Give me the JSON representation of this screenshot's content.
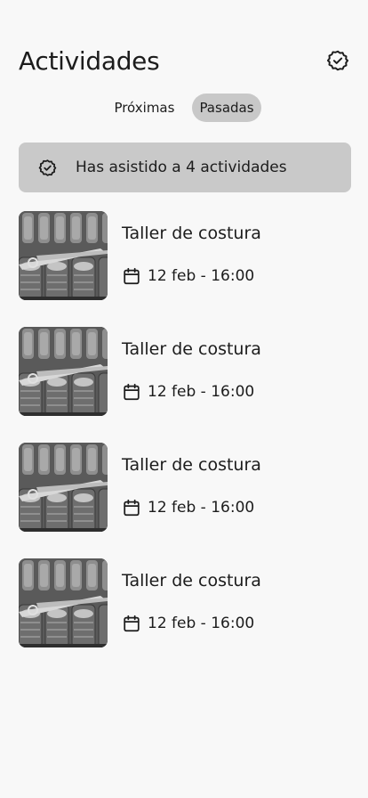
{
  "header": {
    "title": "Actividades",
    "action_icon": "badge-check-icon"
  },
  "tabs": [
    {
      "label": "Próximas",
      "active": false
    },
    {
      "label": "Pasadas",
      "active": true
    }
  ],
  "banner": {
    "icon": "badge-check-icon",
    "text": "Has asistido a 4 actividades"
  },
  "activities": [
    {
      "title": "Taller de costura",
      "date": "12 feb - 16:00",
      "icon": "calendar-icon"
    },
    {
      "title": "Taller de costura",
      "date": "12 feb - 16:00",
      "icon": "calendar-icon"
    },
    {
      "title": "Taller de costura",
      "date": "12 feb - 16:00",
      "icon": "calendar-icon"
    },
    {
      "title": "Taller de costura",
      "date": "12 feb - 16:00",
      "icon": "calendar-icon"
    }
  ]
}
